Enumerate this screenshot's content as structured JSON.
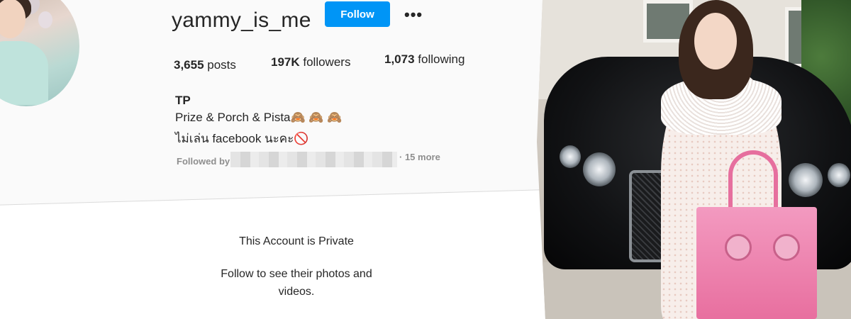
{
  "profile": {
    "username": "yammy_is_me",
    "follow_label": "Follow",
    "more_icon": "•••",
    "stats": {
      "posts_count": "3,655",
      "posts_label": " posts",
      "followers_count": "197K",
      "followers_label": " followers",
      "following_count": "1,073",
      "following_label": " following"
    },
    "bio": {
      "name": "TP",
      "line1": "Prize & Porch & Pista🙈 🙈 🙈",
      "line2": "ไม่เล่น facebook นะคะ🚫"
    },
    "followed_by_label": "Followed by",
    "followed_more": "· 15 more"
  },
  "private": {
    "title": "This Account is Private",
    "subtitle": "Follow to see their photos and videos."
  },
  "colors": {
    "follow_button": "#0095f6",
    "text": "#262626",
    "muted": "#8e8e8e"
  }
}
